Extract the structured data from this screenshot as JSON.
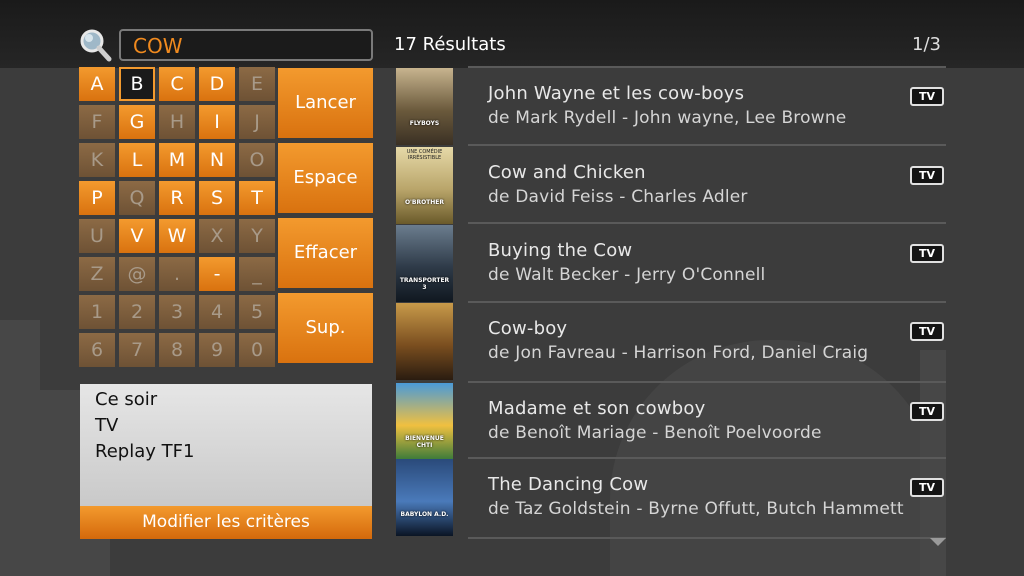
{
  "search": {
    "query": "COW"
  },
  "header": {
    "results_count": "17 Résultats",
    "page_indicator": "1/3"
  },
  "keyboard": {
    "keys": [
      "A",
      "B",
      "C",
      "D",
      "E",
      "F",
      "G",
      "H",
      "I",
      "J",
      "K",
      "L",
      "M",
      "N",
      "O",
      "P",
      "Q",
      "R",
      "S",
      "T",
      "U",
      "V",
      "W",
      "X",
      "Y",
      "Z",
      "@",
      ".",
      "-",
      "_",
      "1",
      "2",
      "3",
      "4",
      "5",
      "6",
      "7",
      "8",
      "9",
      "0"
    ],
    "selected": "B",
    "actions": [
      "Lancer",
      "Espace",
      "Effacer",
      "Sup."
    ]
  },
  "criteria": {
    "items": [
      "Ce soir",
      "TV",
      "Replay TF1"
    ],
    "modify_label": "Modifier les critères"
  },
  "results": [
    {
      "title": "John Wayne et les cow-boys",
      "subtitle": "de Mark Rydell - John wayne, Lee Browne",
      "badge": "TV",
      "poster_text": "FLYBOYS"
    },
    {
      "title": "Cow and Chicken",
      "subtitle": "de David Feiss - Charles Adler",
      "badge": "TV",
      "poster_text": "O'BROTHER",
      "poster_top_text": "UNE COMÉDIE IRRÉSISTIBLE"
    },
    {
      "title": "Buying the Cow",
      "subtitle": "de Walt Becker - Jerry O'Connell",
      "badge": "TV",
      "poster_text": "TRANSPORTER 3"
    },
    {
      "title": "Cow-boy",
      "subtitle": "de Jon Favreau - Harrison Ford, Daniel Craig",
      "badge": "TV",
      "poster_text": ""
    },
    {
      "title": "Madame et son cowboy",
      "subtitle": "de Benoît Mariage - Benoît Poelvoorde",
      "badge": "TV",
      "poster_text": "BIENVENUE CHTI"
    },
    {
      "title": "The Dancing Cow",
      "subtitle": "de Taz Goldstein - Byrne Offutt, Butch Hammett",
      "badge": "TV",
      "poster_text": "BABYLON A.D."
    }
  ],
  "colors": {
    "accent": "#f39a2e",
    "accent_dark": "#d9720f",
    "background": "#3c3c3c"
  }
}
